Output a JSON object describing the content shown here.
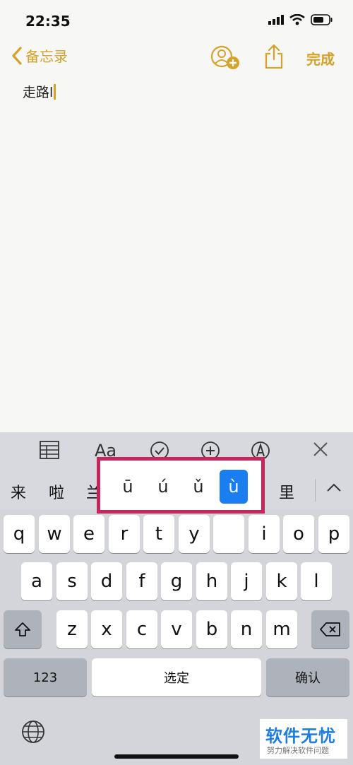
{
  "status_bar": {
    "time": "22:35"
  },
  "nav": {
    "back_label": "备忘录",
    "done_label": "完成"
  },
  "note": {
    "text": "走路l"
  },
  "candidates": [
    "来",
    "啦",
    "兰",
    "里"
  ],
  "accent_options": [
    "ū",
    "ú",
    "ǔ",
    "ù"
  ],
  "accent_selected": "ù",
  "keyboard": {
    "row1": [
      "q",
      "w",
      "e",
      "r",
      "t",
      "y",
      "",
      "i",
      "o",
      "p"
    ],
    "row2": [
      "a",
      "s",
      "d",
      "f",
      "g",
      "h",
      "j",
      "k",
      "l"
    ],
    "row3": [
      "z",
      "x",
      "c",
      "v",
      "b",
      "n",
      "m"
    ],
    "numbers_label": "123",
    "space_label": "选定",
    "confirm_label": "确认"
  },
  "watermark": {
    "title": "软件无忧",
    "subtitle": "努力解决软件问题"
  },
  "colors": {
    "accent": "#d6a22a",
    "highlight_border": "#c4275e",
    "selected": "#1a7df0"
  }
}
